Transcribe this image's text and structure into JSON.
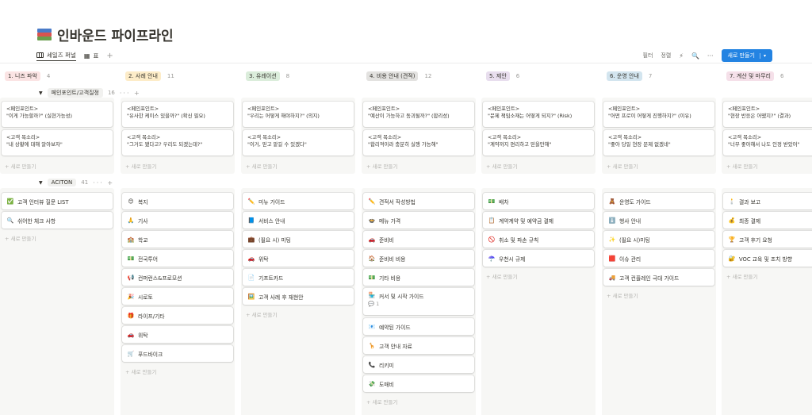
{
  "page": {
    "title": "인바운드 파이프라인"
  },
  "views": {
    "tabs": [
      {
        "label": "세일즈 퍼널"
      },
      {
        "label": "표"
      }
    ],
    "add": "+"
  },
  "toolbar": {
    "filter": "필터",
    "sort": "정렬",
    "lightning": "⚡",
    "search": "🔍",
    "more": "···",
    "new_label": "새로 만들기",
    "new_caret": "▾"
  },
  "columns": [
    {
      "label": "1. 니즈 파악",
      "count": "4",
      "color": "#fbe4e4"
    },
    {
      "label": "2. 사례 안내",
      "count": "11",
      "color": "#fdecc8"
    },
    {
      "label": "3. 유레이션",
      "count": "8",
      "color": "#dbeddb"
    },
    {
      "label": "4. 비용 안내 (견적)",
      "count": "12",
      "color": "#e3e2e0"
    },
    {
      "label": "5. 제안",
      "count": "6",
      "color": "#e8deee"
    },
    {
      "label": "6. 운영 안내",
      "count": "7",
      "color": "#d3e5ef"
    },
    {
      "label": "7. 계산 및 마무리",
      "count": "6",
      "color": "#f5e0e9"
    }
  ],
  "groups": [
    {
      "label": "페인포인트/고객질정",
      "count": "16",
      "tools": "··· +"
    },
    {
      "label": "ACITON",
      "count": "41",
      "tools": "··· +"
    }
  ],
  "pain_cards": [
    [
      {
        "l1": "<페인포인트>",
        "l2": "\"이게 가능할까?\" (실현가능성)"
      },
      {
        "l1": "<고객 목소리>",
        "l2": "\"내 상황에 대해 알아보자\""
      }
    ],
    [
      {
        "l1": "<페인포인트>",
        "l2": "\"유사한 케이스 있을까?\" (확신 필요)"
      },
      {
        "l1": "<고객 목소리>",
        "l2": "\"그거도 됐다고? 우리도 되겠는데?\""
      }
    ],
    [
      {
        "l1": "<페인포인트>",
        "l2": "\"우리는 어떻게 해야하지?\" (의지)"
      },
      {
        "l1": "<고객 목소리>",
        "l2": "\"이거, 믿고 맡길 수 있겠다\""
      }
    ],
    [
      {
        "l1": "<페인포인트>",
        "l2": "\"예산이 가능하고 동괴될까?\" (합리성)"
      },
      {
        "l1": "<고객 목소리>",
        "l2": "\"합리적이라 충분히 실행 가능해\""
      }
    ],
    [
      {
        "l1": "<페인포인트>",
        "l2": "\"문제 책임소재는 어떻게 되지?\" (Risk)"
      },
      {
        "l1": "<고객 목소리>",
        "l2": "\"계약까지 편리하고 믿을만해\""
      }
    ],
    [
      {
        "l1": "<페인포인트>",
        "l2": "\"어떤 프로이 어떻게 진행하지?\" (이유)"
      },
      {
        "l1": "<고객 목소리>",
        "l2": "\"좋아 당일 현장 문제 없겠네\""
      }
    ],
    [
      {
        "l1": "<페인포인트>",
        "l2": "\"현장 반응은 어땠지?\" (결과)"
      },
      {
        "l1": "<고객 목소리>",
        "l2": "\"너무 좋아해서 나도 인정 받았어\""
      }
    ]
  ],
  "action_cards": [
    [
      {
        "icon": "✅",
        "label": "고객 인터뷰 질문 LIST"
      },
      {
        "icon": "🔍",
        "label": "쉬어한 체크 사항"
      }
    ],
    [
      {
        "icon": "😊",
        "label": "복지"
      },
      {
        "icon": "🙏",
        "label": "기사"
      },
      {
        "icon": "🏫",
        "label": "학교"
      },
      {
        "icon": "💵",
        "label": "전국투어"
      },
      {
        "icon": "📢",
        "label": "컨퍼런스&프로모션"
      },
      {
        "icon": "🎉",
        "label": "시로토"
      },
      {
        "icon": "🎁",
        "label": "라이프/기타"
      },
      {
        "icon": "🚗",
        "label": "위탁"
      },
      {
        "icon": "🛒",
        "label": "푸드바이크"
      }
    ],
    [
      {
        "icon": "✏️",
        "label": "미뉴 가이드"
      },
      {
        "icon": "📘",
        "label": "서비스 안내"
      },
      {
        "icon": "💼",
        "label": "(필요 시) 미팅"
      },
      {
        "icon": "🚗",
        "label": "위탁"
      },
      {
        "icon": "📄",
        "label": "기프트카드"
      },
      {
        "icon": "🖼️",
        "label": "고객 사례 후 재현안"
      }
    ],
    [
      {
        "icon": "✏️",
        "label": "견적서 작성방법"
      },
      {
        "icon": "🍲",
        "label": "메뉴 가격"
      },
      {
        "icon": "🚗",
        "label": "준비비"
      },
      {
        "icon": "🏠",
        "label": "준비비 비용"
      },
      {
        "icon": "💵",
        "label": "기타 비용"
      },
      {
        "icon": "🏪",
        "label": "커서 및 시작 가이드",
        "comment": "💬 1"
      },
      {
        "icon": "📧",
        "label": "예약된 가이드"
      },
      {
        "icon": "🦒",
        "label": "고객 안내 자료"
      },
      {
        "icon": "📞",
        "label": "리키미"
      },
      {
        "icon": "💸",
        "label": "도매비"
      }
    ],
    [
      {
        "icon": "💵",
        "label": "배차"
      },
      {
        "icon": "📋",
        "label": "계약계약 및 예약금 결제"
      },
      {
        "icon": "🚫",
        "label": "취소 및 파손 규칙"
      },
      {
        "icon": "☂️",
        "label": "우천시 규제"
      }
    ],
    [
      {
        "icon": "🧸",
        "label": "운영도 가이드"
      },
      {
        "icon": "⬇️",
        "label": "행사 안내"
      },
      {
        "icon": "✨",
        "label": "(필요 시)미팅"
      },
      {
        "icon": "🟥",
        "label": "이슈 관리"
      },
      {
        "icon": "🚚",
        "label": "고객 컨플레인 극대 가이드"
      }
    ],
    [
      {
        "icon": "🕯️",
        "label": "결과 보고"
      },
      {
        "icon": "💰",
        "label": "최종 결제"
      },
      {
        "icon": "🏆",
        "label": "고객 후기 요청"
      },
      {
        "icon": "🔐",
        "label": "VOC 교육 및 조치 방향"
      }
    ]
  ],
  "add_new_label": "+ 새로 만들기"
}
